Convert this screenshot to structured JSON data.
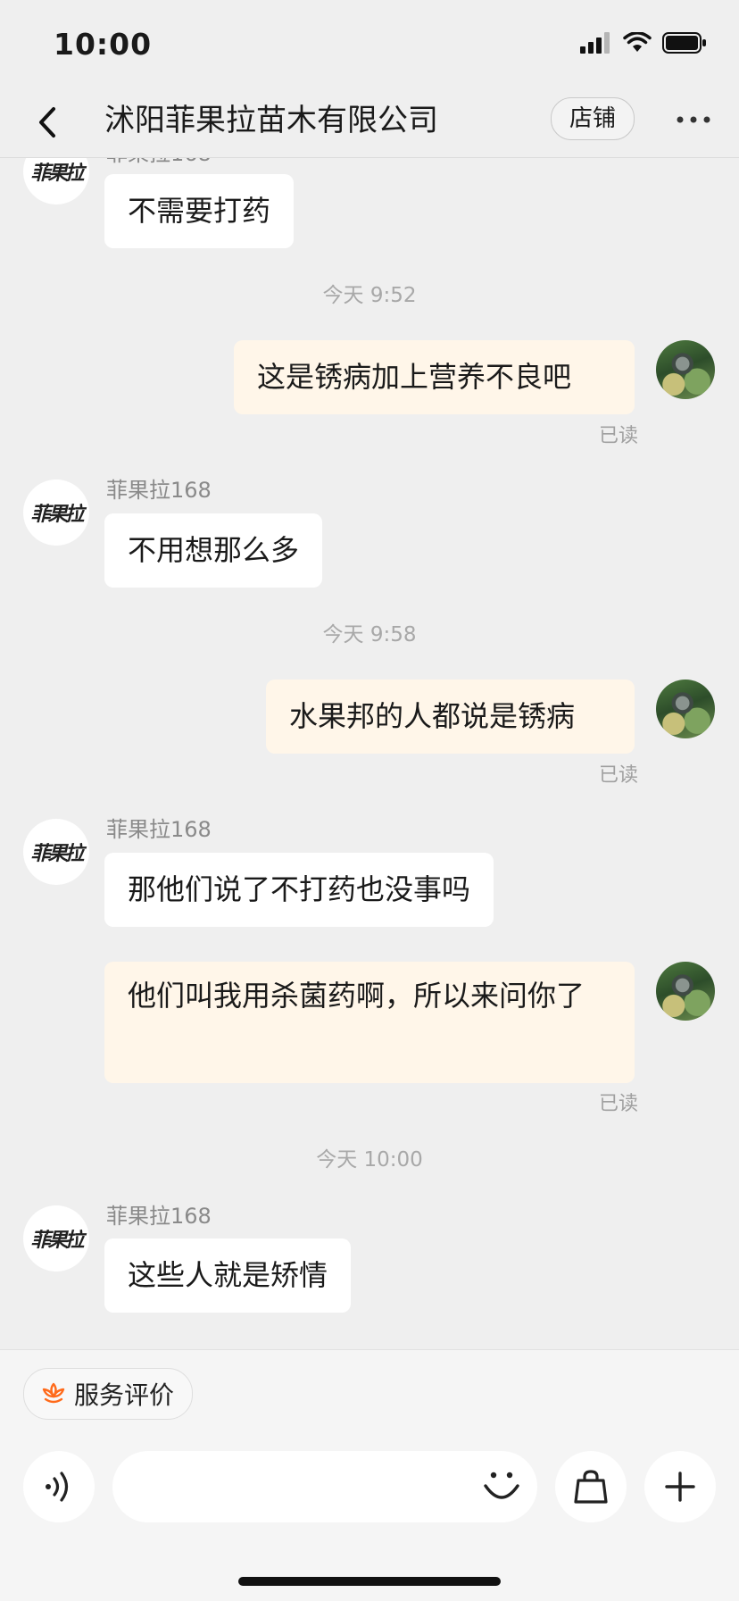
{
  "status_bar": {
    "time": "10:00"
  },
  "header": {
    "title": "沭阳菲果拉苗木有限公司",
    "shop_label": "店铺"
  },
  "chat": {
    "partial_sender": "菲果拉168",
    "seller_avatar_text": "菲果拉",
    "messages": [
      {
        "text": "不需要打药"
      },
      {
        "time": "今天 9:52"
      },
      {
        "text": "这是锈病加上营养不良吧",
        "read": "已读"
      },
      {
        "sender": "菲果拉168",
        "text": "不用想那么多"
      },
      {
        "time": "今天 9:58"
      },
      {
        "text": "水果邦的人都说是锈病",
        "read": "已读"
      },
      {
        "sender": "菲果拉168",
        "text": "那他们说了不打药也没事吗"
      },
      {
        "text": "他们叫我用杀菌药啊，所以来问你了",
        "read": "已读"
      },
      {
        "time": "今天 10:00"
      },
      {
        "sender": "菲果拉168",
        "text": "这些人就是矫情"
      }
    ]
  },
  "footer": {
    "review_label": "服务评价",
    "input_placeholder": "",
    "accent_color": "#ff6a1a"
  }
}
